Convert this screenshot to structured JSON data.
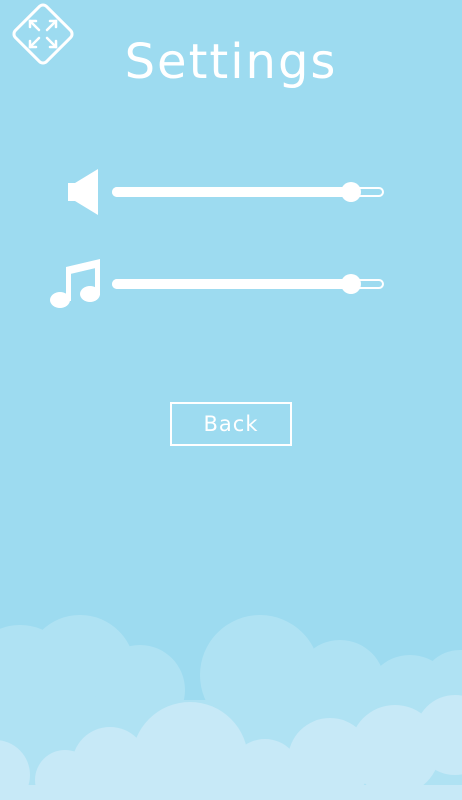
{
  "header": {
    "title": "Settings",
    "fullscreen_icon": "expand-arrows-icon"
  },
  "audio": {
    "sfx": {
      "icon": "speaker-icon",
      "volume": 0.88
    },
    "music": {
      "icon": "music-note-icon",
      "volume": 0.88
    }
  },
  "footer": {
    "back_label": "Back"
  },
  "colors": {
    "background": "#9ddbf0",
    "foreground": "#ffffff",
    "cloud_back": "#afe2f3",
    "cloud_front": "#c7e9f7"
  }
}
